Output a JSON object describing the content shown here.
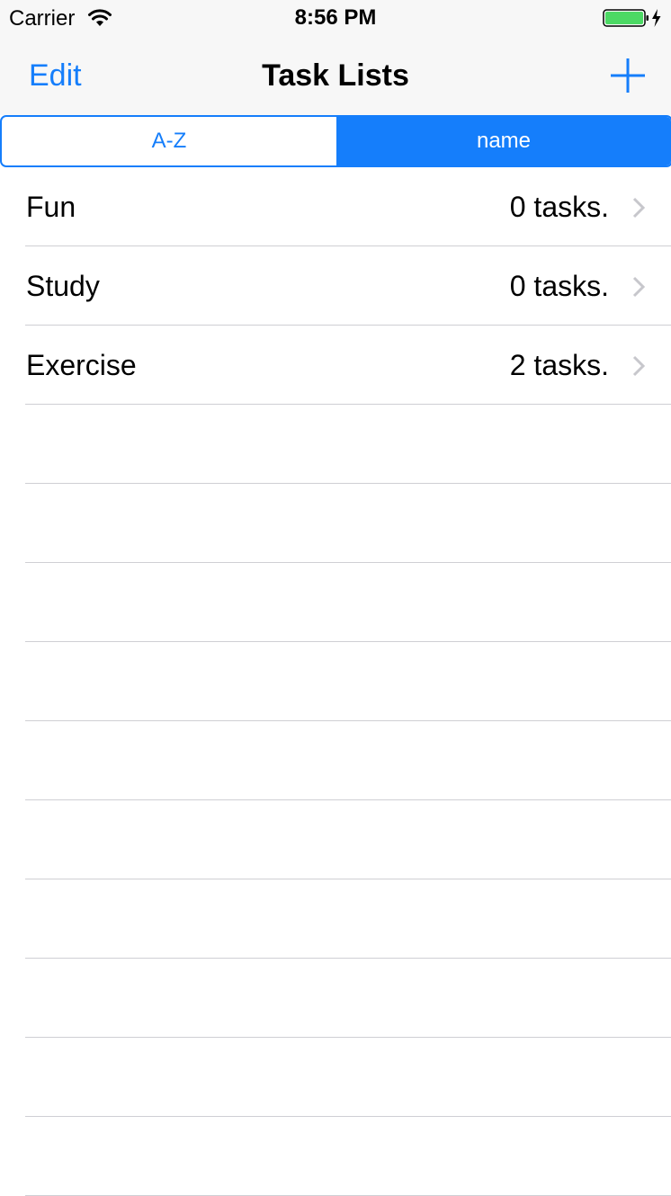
{
  "status_bar": {
    "carrier": "Carrier",
    "time": "8:56 PM",
    "wifi_icon": "wifi-icon",
    "battery_icon": "battery-charging-icon",
    "battery_color": "#4cd964"
  },
  "nav": {
    "edit_label": "Edit",
    "title": "Task Lists",
    "add_icon": "plus-icon"
  },
  "segmented": {
    "options": [
      "A-Z",
      "name"
    ],
    "selected": "name"
  },
  "task_lists": [
    {
      "title": "Fun",
      "count": "0 tasks."
    },
    {
      "title": "Study",
      "count": "0 tasks."
    },
    {
      "title": "Exercise",
      "count": "2 tasks."
    }
  ],
  "colors": {
    "accent": "#157efb",
    "separator": "#cfcfd4",
    "chevron": "#c7c7cc",
    "nav_background": "#f7f7f7"
  }
}
